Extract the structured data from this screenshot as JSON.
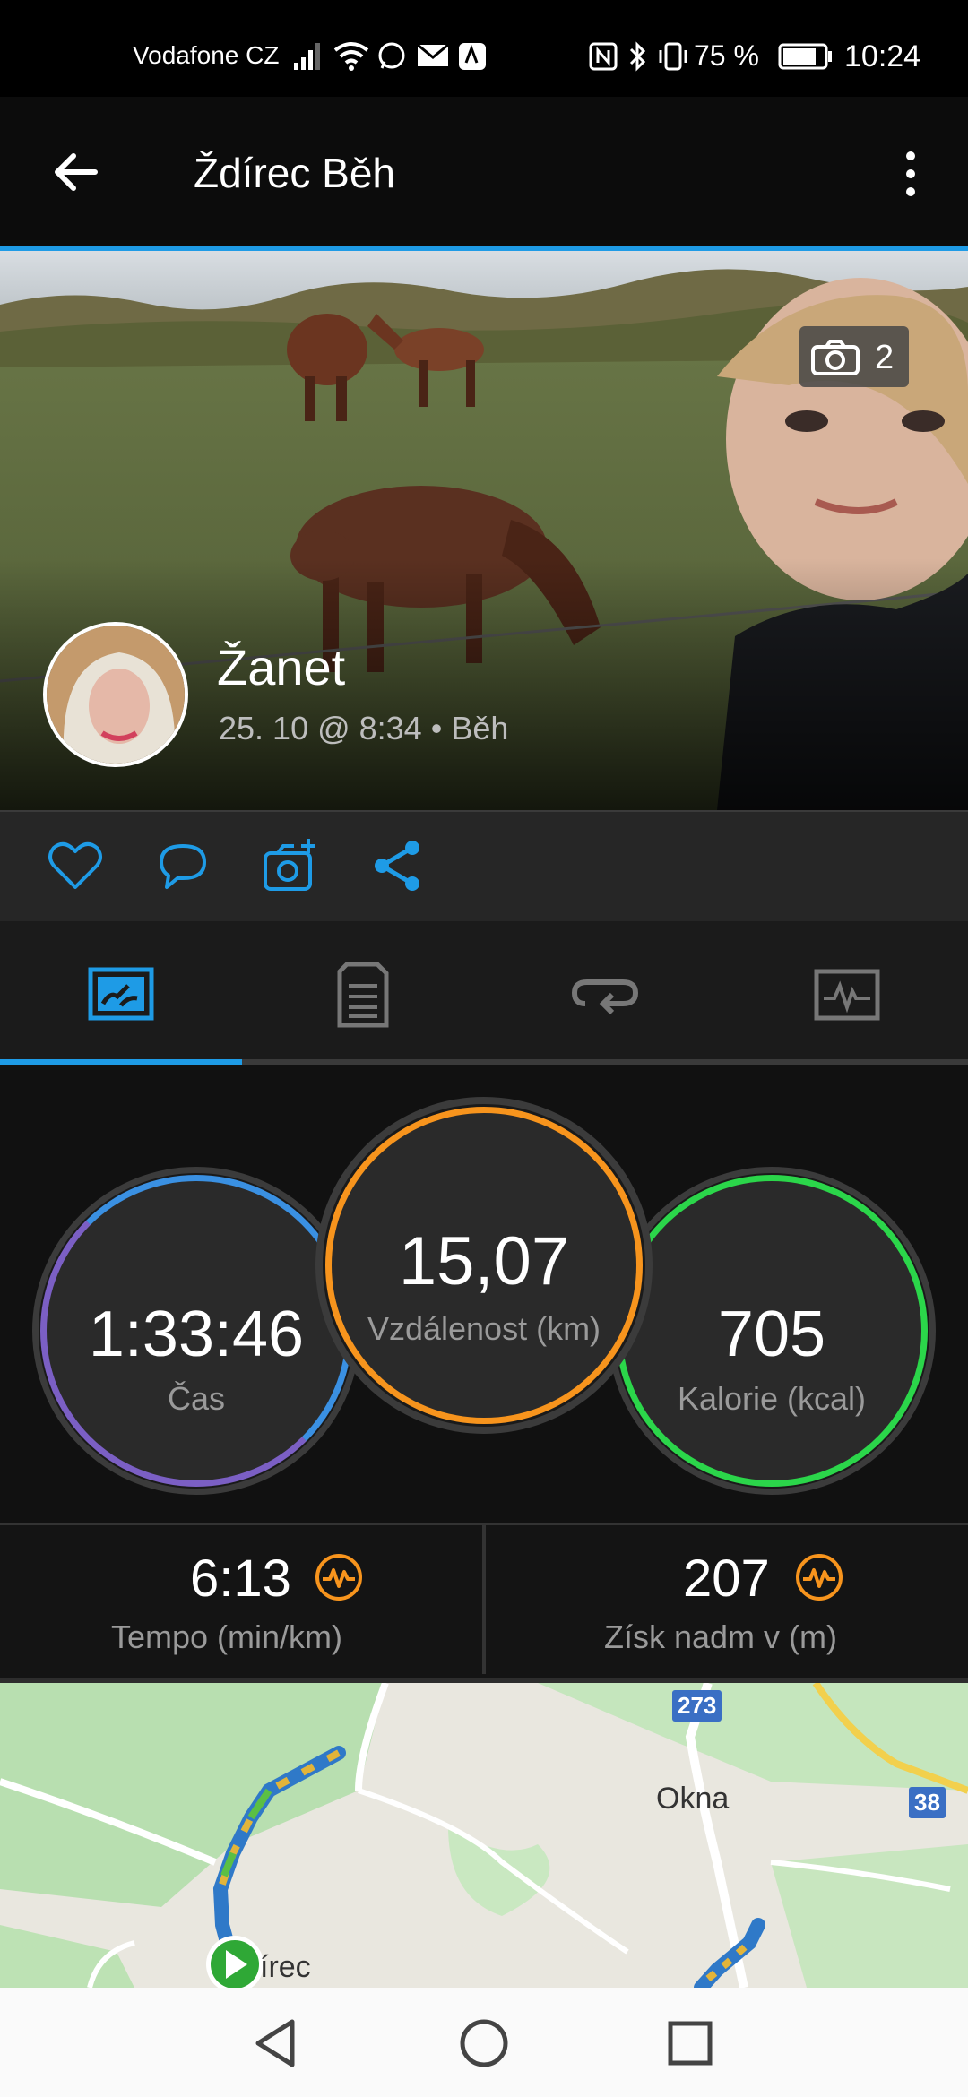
{
  "status_bar": {
    "carrier": "Vodafone CZ",
    "battery": "75 %",
    "time": "10:24"
  },
  "app_bar": {
    "title": "Ždírec Běh"
  },
  "hero": {
    "photo_count": "2",
    "user_name": "Žanet",
    "meta": "25. 10 @ 8:34 • Běh"
  },
  "stats": {
    "time": {
      "value": "1:33:46",
      "label": "Čas"
    },
    "distance": {
      "value": "15,07",
      "label": "Vzdálenost (km)"
    },
    "calories": {
      "value": "705",
      "label": "Kalorie (kcal)"
    }
  },
  "metrics": {
    "pace": {
      "value": "6:13",
      "label": "Tempo (min/km)"
    },
    "elevation": {
      "value": "207",
      "label": "Získ nadm v (m)"
    }
  },
  "map": {
    "road_273": "273",
    "road_38": "38",
    "place_okna": "Okna",
    "place_zdirec": "írec"
  },
  "colors": {
    "accent": "#1e9be6",
    "time_ring": "#6a6fd8",
    "distance_ring": "#f7941d",
    "calories_ring": "#2bd64a",
    "pulse_icon": "#f7941d"
  }
}
